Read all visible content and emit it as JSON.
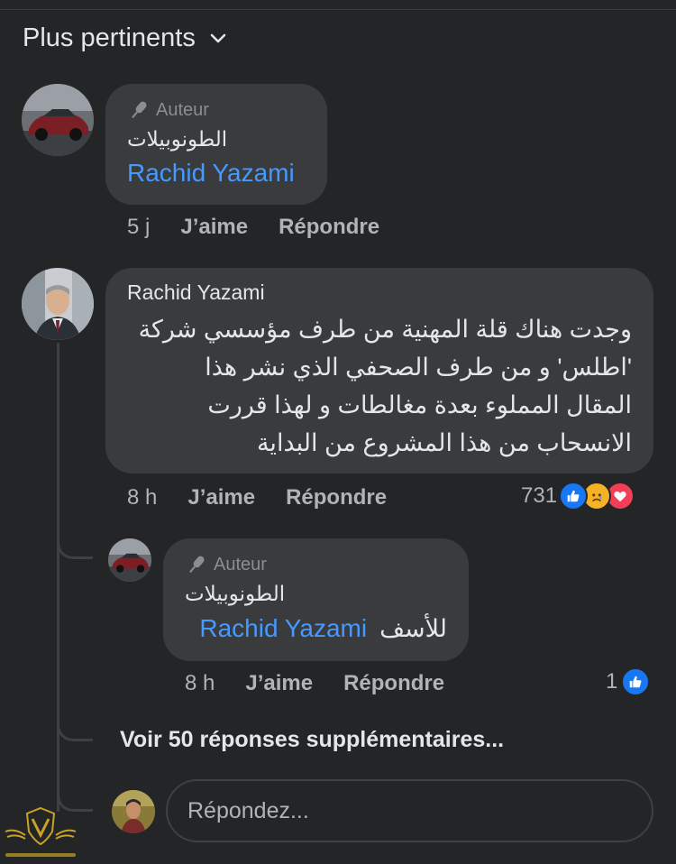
{
  "sort": {
    "label": "Plus pertinents"
  },
  "comments": [
    {
      "author_badge": "Auteur",
      "author": "الطونوبيلات",
      "mention": "Rachid Yazami",
      "time": "5 j",
      "like": "J’aime",
      "reply": "Répondre"
    },
    {
      "author": "Rachid Yazami",
      "lines": [
        "وجدت هناك قلة المهنية من طرف مؤسسي شركة",
        "'اطلس' و من طرف الصحفي الذي نشر هذا",
        "المقال المملوء بعدة مغالطات و لهذا قررت",
        "الانسحاب من هذا المشروع من البداية"
      ],
      "time": "8 h",
      "like": "J’aime",
      "reply": "Répondre",
      "reaction_count": "731",
      "reactions": [
        "like",
        "sad",
        "love"
      ]
    }
  ],
  "reply": {
    "author_badge": "Auteur",
    "author": "الطونوبيلات",
    "mention": "Rachid Yazami",
    "text": "للأسف",
    "time": "8 h",
    "like": "J’aime",
    "reply": "Répondre",
    "reaction_count": "1",
    "reactions": [
      "like"
    ]
  },
  "more_replies": "Voir 50 réponses supplémentaires...",
  "composer": {
    "placeholder": "Répondez..."
  },
  "colors": {
    "background": "#242526",
    "bubble": "#3a3b3c",
    "mention": "#4599ff",
    "like": "#1877f2",
    "love": "#f33e58",
    "sad": "#f7b125"
  }
}
